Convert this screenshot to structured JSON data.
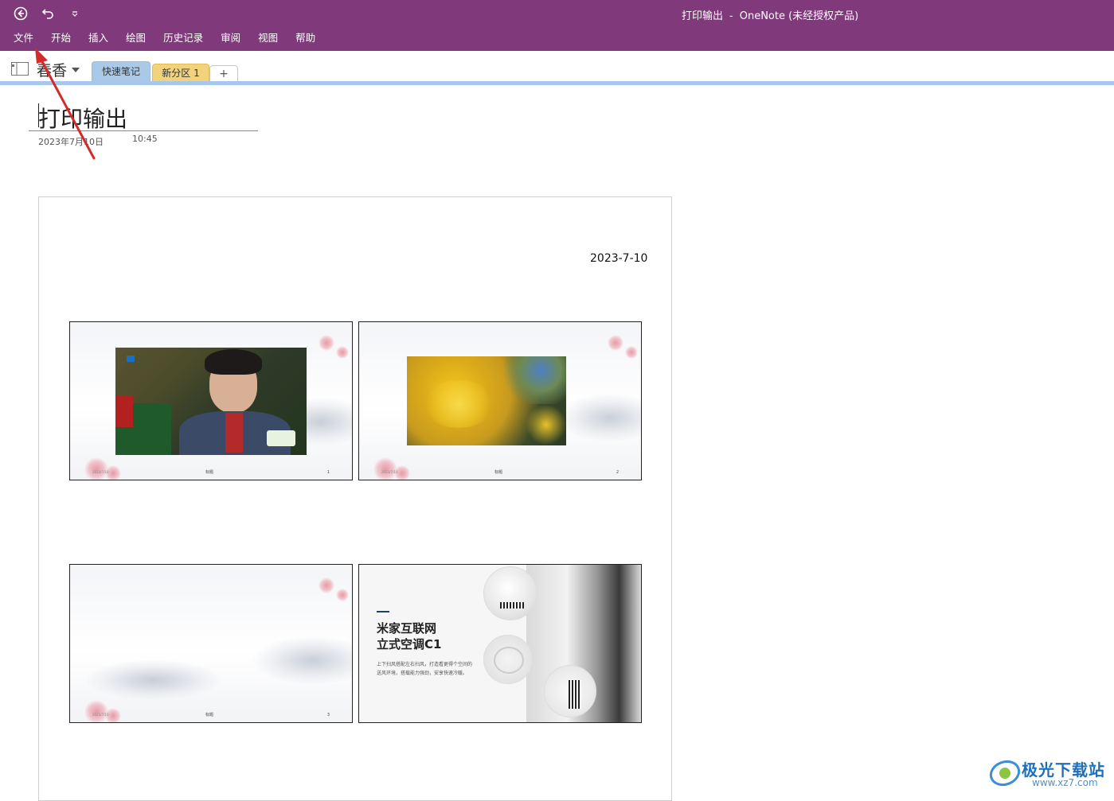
{
  "window": {
    "title": "打印输出",
    "separator": "-",
    "app": "OneNote (未经授权产品)"
  },
  "qat": {
    "back_icon": "back-circle-icon",
    "undo_icon": "undo-icon",
    "customize_icon": "dropdown-caret-icon"
  },
  "menu": [
    "文件",
    "开始",
    "插入",
    "绘图",
    "历史记录",
    "审阅",
    "视图",
    "帮助"
  ],
  "notebook": {
    "name": "春香",
    "tabs": [
      "快速笔记",
      "新分区 1",
      "+"
    ]
  },
  "page": {
    "title": "打印输出",
    "date": "2023年7月10日",
    "time": "10:45"
  },
  "printout": {
    "date": "2023-7-10",
    "slides": [
      {
        "foot_left": "2023/7/10",
        "foot_center": "标题",
        "number": "1"
      },
      {
        "foot_left": "2023/7/10",
        "foot_center": "标题",
        "number": "2"
      },
      {
        "foot_left": "2023/7/10",
        "foot_center": "标题",
        "number": "3"
      },
      {
        "heading": "米家互联网\n立式空调C1",
        "body": "上下扫风搭配左右扫风，打造看更得个空间的送风环境，搭载能力强劲，安享快速冷暖。"
      }
    ]
  },
  "watermark": {
    "text": "极光下载站",
    "url": "www.xz7.com"
  },
  "colors": {
    "titlebar": "#80397b",
    "tab_quick_notes": "#a9c9e8",
    "tab_new_section": "#f2d27a",
    "annotation_arrow": "#d42a2a"
  }
}
